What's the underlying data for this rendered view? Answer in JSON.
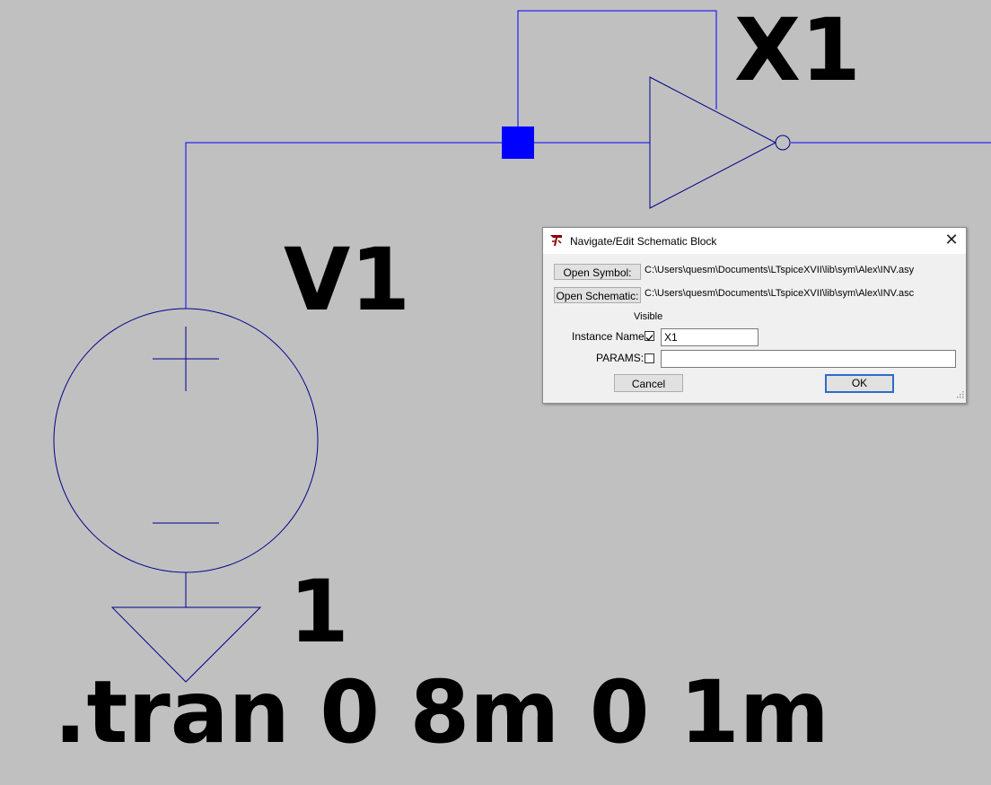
{
  "schematic": {
    "instance_label": "X1",
    "source_label": "V1",
    "source_value": "1",
    "directive": ".tran 0 8m 0 1m",
    "wire_color": "#0000ff",
    "symbol_color": "#00008b"
  },
  "dialog": {
    "title": "Navigate/Edit Schematic Block",
    "open_symbol_label": "Open Symbol:",
    "symbol_path": "C:\\Users\\quesm\\Documents\\LTspiceXVII\\lib\\sym\\Alex\\INV.asy",
    "open_schematic_label": "Open Schematic:",
    "schematic_path": "C:\\Users\\quesm\\Documents\\LTspiceXVII\\lib\\sym\\Alex\\INV.asc",
    "visible_header": "Visible",
    "instance_name_label": "Instance Name:",
    "instance_name_visible": true,
    "instance_name_value": "X1",
    "params_label": "PARAMS:",
    "params_visible": false,
    "params_value": "",
    "cancel_label": "Cancel",
    "ok_label": "OK",
    "close_icon": "close-icon",
    "app_icon": "ltspice-app-icon"
  }
}
